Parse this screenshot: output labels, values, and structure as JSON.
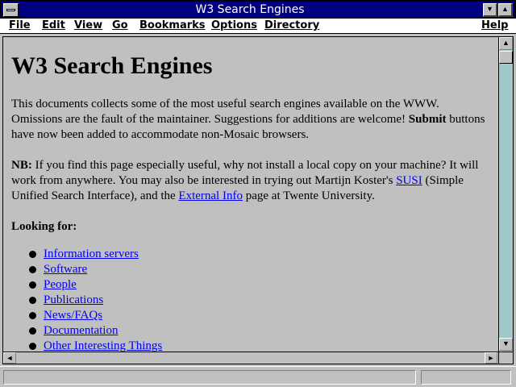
{
  "window": {
    "title": "W3 Search Engines"
  },
  "menu": {
    "file": "File",
    "edit": "Edit",
    "view": "View",
    "go": "Go",
    "bookmarks": "Bookmarks",
    "options": "Options",
    "directory": "Directory",
    "help": "Help"
  },
  "document": {
    "heading": "W3 Search Engines",
    "intro_text": "This documents collects some of the most useful search engines available on the WWW. Omissions are the fault of the maintainer. Suggestions for additions are welcome! ",
    "intro_bold": "Submit",
    "intro_tail": " buttons have now been added to accommodate non-Mosaic browsers.",
    "nb_label": "NB:",
    "nb_text": " If you find this page especially useful, why not install a local copy on your machine? It will work from anywhere. You may also be interested in trying out Martijn Koster's ",
    "susi_link": "SUSI",
    "nb_mid": " (Simple Unified Search Interface), and the ",
    "external_link": "External Info",
    "nb_tail": " page at Twente University.",
    "looking_for": "Looking for:",
    "links": [
      "Information servers",
      "Software",
      "People",
      "Publications",
      "News/FAQs",
      "Documentation",
      "Other Interesting Things"
    ]
  },
  "status": {
    "text": ""
  },
  "icons": {
    "system_menu": "system-menu-icon",
    "minimize": "minimize-arrow-icon",
    "maximize": "maximize-arrow-icon"
  },
  "colors": {
    "title_bar": "#000080",
    "link": "#0000ee",
    "background": "#c0c0c0",
    "scroll_track": "#a0c8c8"
  }
}
